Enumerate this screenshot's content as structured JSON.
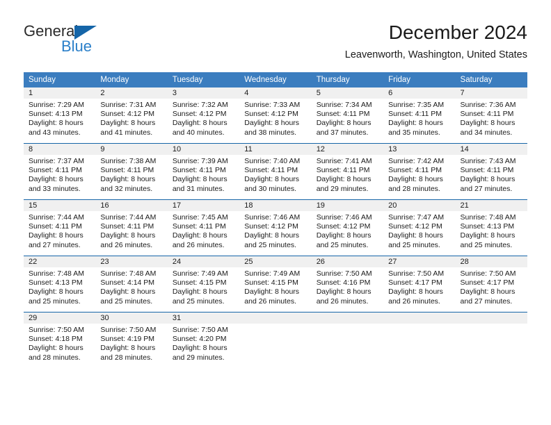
{
  "brand": {
    "name_part1": "General",
    "name_part2": "Blue",
    "triangle_icon": "blue-triangle-logo-mark"
  },
  "header": {
    "title": "December 2024",
    "location": "Leavenworth, Washington, United States"
  },
  "theme": {
    "header_blue": "#3b7dbf",
    "rule_blue": "#1565a8",
    "daynum_band": "#f0f0f0",
    "logo_blue": "#2a7fc9",
    "text": "#1a1a1a"
  },
  "weekdays": [
    "Sunday",
    "Monday",
    "Tuesday",
    "Wednesday",
    "Thursday",
    "Friday",
    "Saturday"
  ],
  "weeks": [
    [
      {
        "day": "1",
        "sunrise": "Sunrise: 7:29 AM",
        "sunset": "Sunset: 4:13 PM",
        "daylight1": "Daylight: 8 hours",
        "daylight2": "and 43 minutes."
      },
      {
        "day": "2",
        "sunrise": "Sunrise: 7:31 AM",
        "sunset": "Sunset: 4:12 PM",
        "daylight1": "Daylight: 8 hours",
        "daylight2": "and 41 minutes."
      },
      {
        "day": "3",
        "sunrise": "Sunrise: 7:32 AM",
        "sunset": "Sunset: 4:12 PM",
        "daylight1": "Daylight: 8 hours",
        "daylight2": "and 40 minutes."
      },
      {
        "day": "4",
        "sunrise": "Sunrise: 7:33 AM",
        "sunset": "Sunset: 4:12 PM",
        "daylight1": "Daylight: 8 hours",
        "daylight2": "and 38 minutes."
      },
      {
        "day": "5",
        "sunrise": "Sunrise: 7:34 AM",
        "sunset": "Sunset: 4:11 PM",
        "daylight1": "Daylight: 8 hours",
        "daylight2": "and 37 minutes."
      },
      {
        "day": "6",
        "sunrise": "Sunrise: 7:35 AM",
        "sunset": "Sunset: 4:11 PM",
        "daylight1": "Daylight: 8 hours",
        "daylight2": "and 35 minutes."
      },
      {
        "day": "7",
        "sunrise": "Sunrise: 7:36 AM",
        "sunset": "Sunset: 4:11 PM",
        "daylight1": "Daylight: 8 hours",
        "daylight2": "and 34 minutes."
      }
    ],
    [
      {
        "day": "8",
        "sunrise": "Sunrise: 7:37 AM",
        "sunset": "Sunset: 4:11 PM",
        "daylight1": "Daylight: 8 hours",
        "daylight2": "and 33 minutes."
      },
      {
        "day": "9",
        "sunrise": "Sunrise: 7:38 AM",
        "sunset": "Sunset: 4:11 PM",
        "daylight1": "Daylight: 8 hours",
        "daylight2": "and 32 minutes."
      },
      {
        "day": "10",
        "sunrise": "Sunrise: 7:39 AM",
        "sunset": "Sunset: 4:11 PM",
        "daylight1": "Daylight: 8 hours",
        "daylight2": "and 31 minutes."
      },
      {
        "day": "11",
        "sunrise": "Sunrise: 7:40 AM",
        "sunset": "Sunset: 4:11 PM",
        "daylight1": "Daylight: 8 hours",
        "daylight2": "and 30 minutes."
      },
      {
        "day": "12",
        "sunrise": "Sunrise: 7:41 AM",
        "sunset": "Sunset: 4:11 PM",
        "daylight1": "Daylight: 8 hours",
        "daylight2": "and 29 minutes."
      },
      {
        "day": "13",
        "sunrise": "Sunrise: 7:42 AM",
        "sunset": "Sunset: 4:11 PM",
        "daylight1": "Daylight: 8 hours",
        "daylight2": "and 28 minutes."
      },
      {
        "day": "14",
        "sunrise": "Sunrise: 7:43 AM",
        "sunset": "Sunset: 4:11 PM",
        "daylight1": "Daylight: 8 hours",
        "daylight2": "and 27 minutes."
      }
    ],
    [
      {
        "day": "15",
        "sunrise": "Sunrise: 7:44 AM",
        "sunset": "Sunset: 4:11 PM",
        "daylight1": "Daylight: 8 hours",
        "daylight2": "and 27 minutes."
      },
      {
        "day": "16",
        "sunrise": "Sunrise: 7:44 AM",
        "sunset": "Sunset: 4:11 PM",
        "daylight1": "Daylight: 8 hours",
        "daylight2": "and 26 minutes."
      },
      {
        "day": "17",
        "sunrise": "Sunrise: 7:45 AM",
        "sunset": "Sunset: 4:11 PM",
        "daylight1": "Daylight: 8 hours",
        "daylight2": "and 26 minutes."
      },
      {
        "day": "18",
        "sunrise": "Sunrise: 7:46 AM",
        "sunset": "Sunset: 4:12 PM",
        "daylight1": "Daylight: 8 hours",
        "daylight2": "and 25 minutes."
      },
      {
        "day": "19",
        "sunrise": "Sunrise: 7:46 AM",
        "sunset": "Sunset: 4:12 PM",
        "daylight1": "Daylight: 8 hours",
        "daylight2": "and 25 minutes."
      },
      {
        "day": "20",
        "sunrise": "Sunrise: 7:47 AM",
        "sunset": "Sunset: 4:12 PM",
        "daylight1": "Daylight: 8 hours",
        "daylight2": "and 25 minutes."
      },
      {
        "day": "21",
        "sunrise": "Sunrise: 7:48 AM",
        "sunset": "Sunset: 4:13 PM",
        "daylight1": "Daylight: 8 hours",
        "daylight2": "and 25 minutes."
      }
    ],
    [
      {
        "day": "22",
        "sunrise": "Sunrise: 7:48 AM",
        "sunset": "Sunset: 4:13 PM",
        "daylight1": "Daylight: 8 hours",
        "daylight2": "and 25 minutes."
      },
      {
        "day": "23",
        "sunrise": "Sunrise: 7:48 AM",
        "sunset": "Sunset: 4:14 PM",
        "daylight1": "Daylight: 8 hours",
        "daylight2": "and 25 minutes."
      },
      {
        "day": "24",
        "sunrise": "Sunrise: 7:49 AM",
        "sunset": "Sunset: 4:15 PM",
        "daylight1": "Daylight: 8 hours",
        "daylight2": "and 25 minutes."
      },
      {
        "day": "25",
        "sunrise": "Sunrise: 7:49 AM",
        "sunset": "Sunset: 4:15 PM",
        "daylight1": "Daylight: 8 hours",
        "daylight2": "and 26 minutes."
      },
      {
        "day": "26",
        "sunrise": "Sunrise: 7:50 AM",
        "sunset": "Sunset: 4:16 PM",
        "daylight1": "Daylight: 8 hours",
        "daylight2": "and 26 minutes."
      },
      {
        "day": "27",
        "sunrise": "Sunrise: 7:50 AM",
        "sunset": "Sunset: 4:17 PM",
        "daylight1": "Daylight: 8 hours",
        "daylight2": "and 26 minutes."
      },
      {
        "day": "28",
        "sunrise": "Sunrise: 7:50 AM",
        "sunset": "Sunset: 4:17 PM",
        "daylight1": "Daylight: 8 hours",
        "daylight2": "and 27 minutes."
      }
    ],
    [
      {
        "day": "29",
        "sunrise": "Sunrise: 7:50 AM",
        "sunset": "Sunset: 4:18 PM",
        "daylight1": "Daylight: 8 hours",
        "daylight2": "and 28 minutes."
      },
      {
        "day": "30",
        "sunrise": "Sunrise: 7:50 AM",
        "sunset": "Sunset: 4:19 PM",
        "daylight1": "Daylight: 8 hours",
        "daylight2": "and 28 minutes."
      },
      {
        "day": "31",
        "sunrise": "Sunrise: 7:50 AM",
        "sunset": "Sunset: 4:20 PM",
        "daylight1": "Daylight: 8 hours",
        "daylight2": "and 29 minutes."
      },
      {
        "day": "",
        "sunrise": "",
        "sunset": "",
        "daylight1": "",
        "daylight2": ""
      },
      {
        "day": "",
        "sunrise": "",
        "sunset": "",
        "daylight1": "",
        "daylight2": ""
      },
      {
        "day": "",
        "sunrise": "",
        "sunset": "",
        "daylight1": "",
        "daylight2": ""
      },
      {
        "day": "",
        "sunrise": "",
        "sunset": "",
        "daylight1": "",
        "daylight2": ""
      }
    ]
  ]
}
